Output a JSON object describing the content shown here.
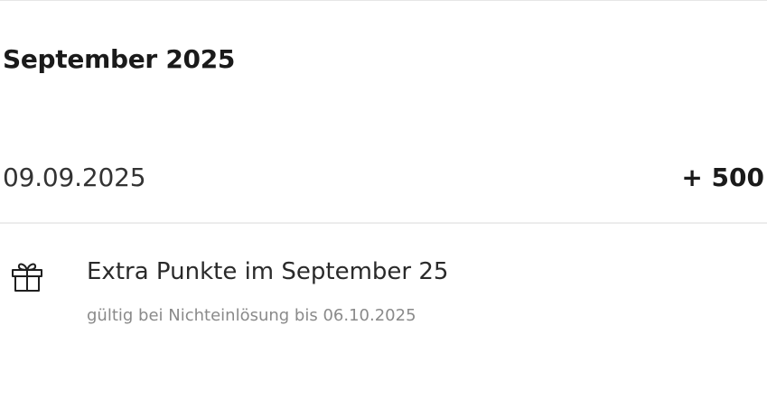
{
  "month_header": {
    "title": "September 2025"
  },
  "entry": {
    "date": "09.09.2025",
    "points": "+ 500"
  },
  "detail": {
    "icon": "gift-icon",
    "title": "Extra Punkte im September 25",
    "validity": "gültig bei Nichteinlösung bis 06.10.2025"
  },
  "colors": {
    "text_primary": "#1a1a1a",
    "text_secondary": "#8a8a8a",
    "divider": "#ececec"
  }
}
